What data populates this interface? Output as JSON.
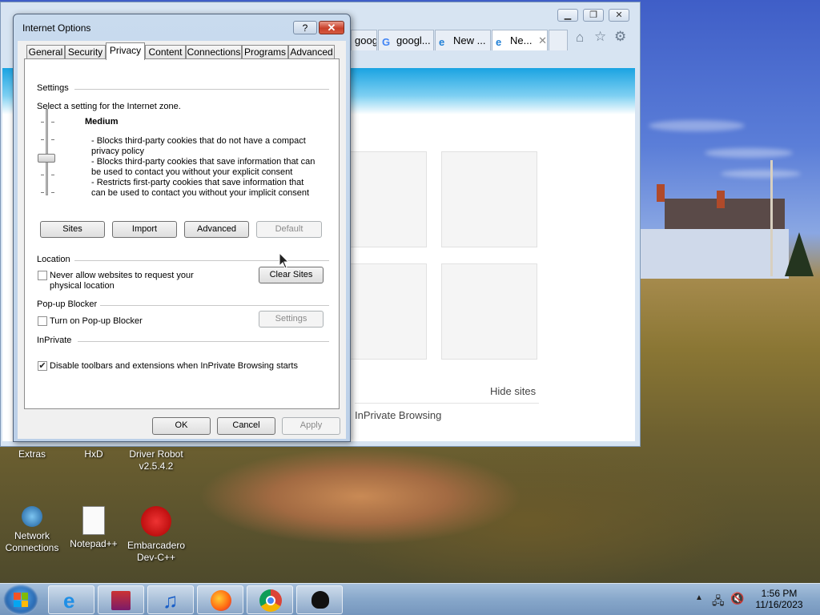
{
  "desktop": {
    "icons": [
      {
        "label": "Extras"
      },
      {
        "label": "HxD"
      },
      {
        "label": "Driver Robot v2.5.4.2"
      },
      {
        "label": "Network Connections"
      },
      {
        "label": "Notepad++"
      },
      {
        "label": "Embarcadero Dev-C++"
      }
    ]
  },
  "browser": {
    "tabs": [
      {
        "label": "googl...",
        "icon": "page-icon"
      },
      {
        "label": "googl...",
        "icon": "google-icon"
      },
      {
        "label": "New ...",
        "icon": "ie-icon"
      },
      {
        "label": "Ne...",
        "icon": "ie-icon",
        "active": true
      }
    ],
    "hide_sites": "Hide sites",
    "inprivate_link": "InPrivate Browsing"
  },
  "dialog": {
    "title": "Internet Options",
    "help": "?",
    "close": "✕",
    "tabs": [
      "General",
      "Security",
      "Privacy",
      "Content",
      "Connections",
      "Programs",
      "Advanced"
    ],
    "active_tab": "Privacy",
    "settings": {
      "group": "Settings",
      "intro": "Select a setting for the Internet zone.",
      "level": "Medium",
      "line1": "- Blocks third-party cookies that do not have a compact privacy policy",
      "line2": "- Blocks third-party cookies that save information that can be used to contact you without your explicit consent",
      "line3": "- Restricts first-party cookies that save information that can be used to contact you without your implicit consent",
      "buttons": {
        "sites": "Sites",
        "import": "Import",
        "advanced": "Advanced",
        "default": "Default"
      }
    },
    "location": {
      "group": "Location",
      "checkbox": "Never allow websites to request your physical location",
      "checked": false,
      "clear_sites": "Clear Sites"
    },
    "popup": {
      "group": "Pop-up Blocker",
      "checkbox": "Turn on Pop-up Blocker",
      "checked": false,
      "settings": "Settings"
    },
    "inprivate": {
      "group": "InPrivate",
      "checkbox": "Disable toolbars and extensions when InPrivate Browsing starts",
      "checked": true
    },
    "footer": {
      "ok": "OK",
      "cancel": "Cancel",
      "apply": "Apply"
    }
  },
  "taskbar": {
    "apps": [
      "internet-explorer",
      "archive-manager",
      "itunes",
      "firefox",
      "chrome",
      "inkscape"
    ],
    "time": "1:56 PM",
    "date": "11/16/2023"
  }
}
